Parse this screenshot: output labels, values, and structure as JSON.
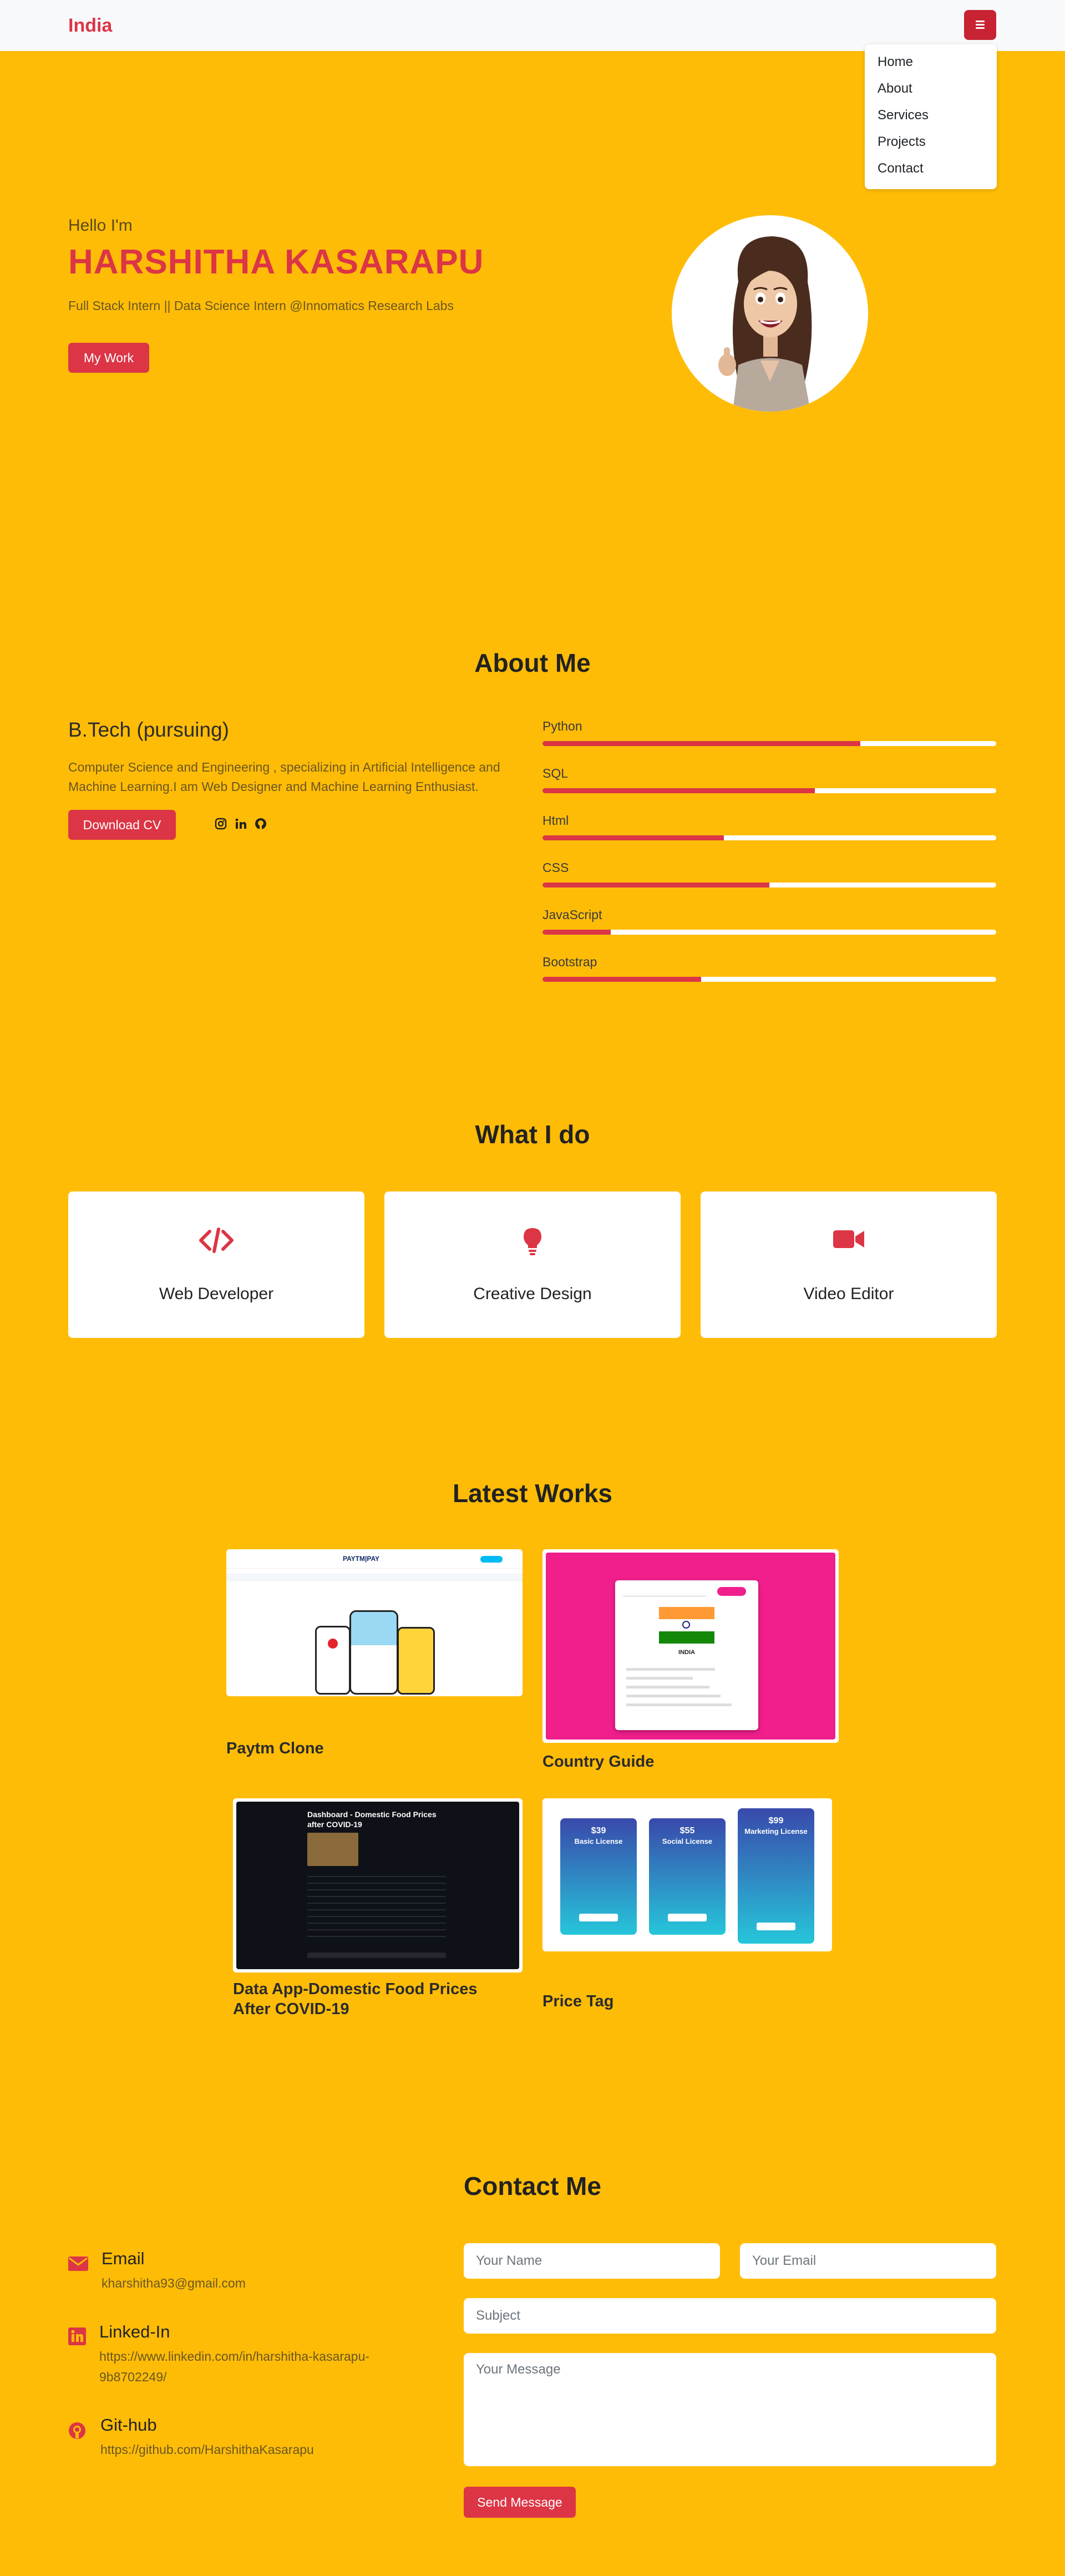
{
  "nav": {
    "brand": "India",
    "menu": [
      "Home",
      "About",
      "Services",
      "Projects",
      "Contact"
    ]
  },
  "hero": {
    "greeting": "Hello I'm",
    "name": "HARSHITHA KASARAPU",
    "role": "Full Stack Intern || Data Science Intern @Innomatics Research Labs",
    "cta": "My Work"
  },
  "about": {
    "title": "About Me",
    "heading": "B.Tech (pursuing)",
    "text": "Computer Science and Engineering , specializing in Artificial Intelligence and Machine Learning.I am Web Designer and Machine Learning Enthusiast.",
    "download": "Download CV",
    "social_icons": [
      "instagram-icon",
      "linkedin-icon",
      "github-icon"
    ],
    "skills": [
      {
        "name": "Python",
        "level": 0.7
      },
      {
        "name": "SQL",
        "level": 0.6
      },
      {
        "name": "Html",
        "level": 0.4
      },
      {
        "name": "CSS",
        "level": 0.5
      },
      {
        "name": "JavaScript",
        "level": 0.15
      },
      {
        "name": "Bootstrap",
        "level": 0.35
      }
    ]
  },
  "services": {
    "title": "What I do",
    "items": [
      {
        "label": "Web Developer",
        "icon": "code-icon"
      },
      {
        "label": "Creative Design",
        "icon": "lightbulb-icon"
      },
      {
        "label": "Video Editor",
        "icon": "video-camera-icon"
      }
    ]
  },
  "works": {
    "title": "Latest Works",
    "items": [
      {
        "title": "Paytm Clone",
        "thumb_logo": "PAYTM|PAY"
      },
      {
        "title": "Country Guide",
        "thumb_caption": "INDIA"
      },
      {
        "title": "Data App-Domestic Food Prices After COVID-19",
        "thumb_caption": "Dashboard - Domestic Food Prices after COVID-19"
      },
      {
        "title": "Price Tag",
        "plans": [
          "Basic License",
          "Social License",
          "Marketing License"
        ],
        "prices": [
          "$39",
          "$55",
          "$99"
        ]
      }
    ]
  },
  "contact": {
    "title": "Contact Me",
    "items": [
      {
        "label": "Email",
        "value": "kharshitha93@gmail.com",
        "icon": "envelope-icon"
      },
      {
        "label": "Linked-In",
        "value": "https://www.linkedin.com/in/harshitha-kasarapu-9b8702249/",
        "icon": "linkedin-icon"
      },
      {
        "label": "Git-hub",
        "value": "https://github.com/HarshithaKasarapu",
        "icon": "github-icon"
      }
    ],
    "form": {
      "name_placeholder": "Your Name",
      "email_placeholder": "Your Email",
      "subject_placeholder": "Subject",
      "message_placeholder": "Your Message",
      "submit": "Send Message"
    }
  },
  "colors": {
    "page_bg": "#FFBC07",
    "accent": "#dc3545",
    "nav_bg": "#f8f9fa",
    "card_bg": "#ffffff"
  }
}
